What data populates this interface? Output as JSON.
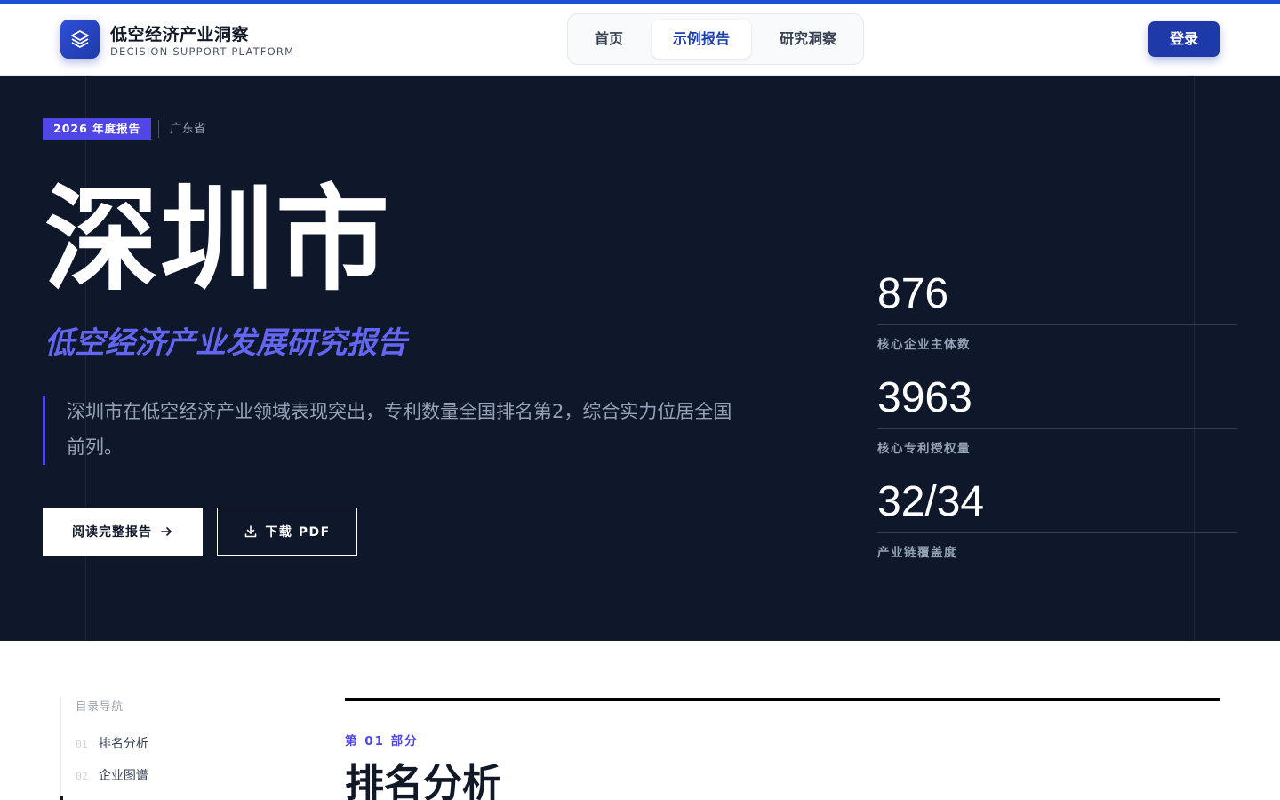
{
  "header": {
    "brand_title": "低空经济产业洞察",
    "brand_subtitle": "DECISION SUPPORT PLATFORM",
    "nav": [
      {
        "label": "首页",
        "active": false
      },
      {
        "label": "示例报告",
        "active": true
      },
      {
        "label": "研究洞察",
        "active": false
      }
    ],
    "login_label": "登录"
  },
  "hero": {
    "year_badge": "2026 年度报告",
    "province": "广东省",
    "city": "深圳市",
    "subtitle": "低空经济产业发展研究报告",
    "description": "深圳市在低空经济产业领域表现突出，专利数量全国排名第2，综合实力位居全国前列。",
    "read_button": "阅读完整报告",
    "pdf_button": "下载 PDF",
    "stats": [
      {
        "value": "876",
        "label": "核心企业主体数"
      },
      {
        "value": "3963",
        "label": "核心专利授权量"
      },
      {
        "value": "32/34",
        "label": "产业链覆盖度"
      }
    ]
  },
  "toc": {
    "title": "目录导航",
    "items": [
      {
        "num": "01",
        "label": "排名分析"
      },
      {
        "num": "02",
        "label": "企业图谱"
      }
    ]
  },
  "section": {
    "label": "第 01 部分",
    "title": "排名分析"
  },
  "colors": {
    "accent": "#4f46e5",
    "brand": "#1e3aa8",
    "hero_bg": "#0f172a"
  }
}
